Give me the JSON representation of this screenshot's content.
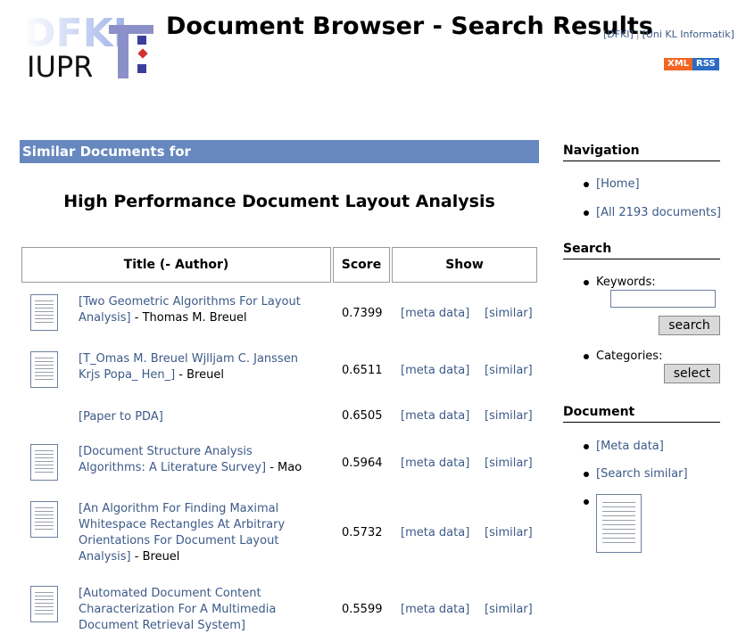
{
  "header": {
    "logo_text": "IUPR",
    "title": "Document Browser - Search Results",
    "links": [
      "[DFKI]",
      "[Uni KL Informatik]"
    ],
    "badge": {
      "left": "XML",
      "right": "RSS"
    }
  },
  "main": {
    "bar_label": "Similar Documents for",
    "doc_title": "High Performance Document Layout Analysis",
    "columns": [
      "Title (- Author)",
      "Score",
      "Show"
    ],
    "rows": [
      {
        "title": "[Two Geometric Algorithms For Layout Analysis]",
        "author": " - Thomas M. Breuel",
        "score": "0.7399",
        "meta": "[meta data]",
        "similar": "[similar]",
        "thumb": true
      },
      {
        "title": "[T_Omas M. Breuel Wjlljam C. Janssen Krjs Popa_ Hen_]",
        "author": " - Breuel",
        "score": "0.6511",
        "meta": "[meta data]",
        "similar": "[similar]",
        "thumb": true
      },
      {
        "title": "[Paper to PDA]",
        "author": "",
        "score": "0.6505",
        "meta": "[meta data]",
        "similar": "[similar]",
        "thumb": false
      },
      {
        "title": "[Document Structure Analysis Algorithms: A Literature Survey]",
        "author": " - Mao",
        "score": "0.5964",
        "meta": "[meta data]",
        "similar": "[similar]",
        "thumb": true
      },
      {
        "title": "[An Algorithm For Finding Maximal Whitespace Rectangles At Arbitrary Orientations For Document Layout Analysis]",
        "author": " - Breuel",
        "score": "0.5732",
        "meta": "[meta data]",
        "similar": "[similar]",
        "thumb": true
      },
      {
        "title": "[Automated Document Content Characterization For A Multimedia Document Retrieval System]",
        "author": "",
        "score": "0.5599",
        "meta": "[meta data]",
        "similar": "[similar]",
        "thumb": true
      }
    ]
  },
  "sidebar": {
    "navigation": {
      "heading": "Navigation",
      "items": [
        "[Home]",
        "[All 2193 documents]"
      ]
    },
    "search": {
      "heading": "Search",
      "keywords_label": "Keywords:",
      "keywords_value": "",
      "search_button": "search",
      "categories_label": "Categories:",
      "select_button": "select"
    },
    "document": {
      "heading": "Document",
      "items": [
        "[Meta data]",
        "[Search similar]"
      ]
    }
  }
}
